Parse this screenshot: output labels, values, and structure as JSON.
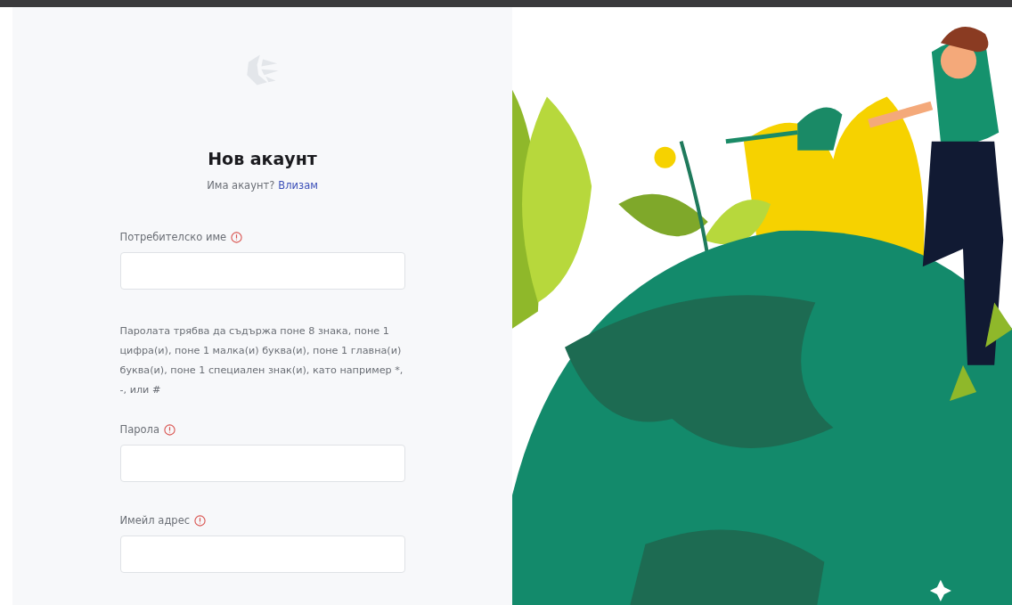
{
  "form": {
    "title": "Нов акаунт",
    "login_prompt": "Има акаунт?",
    "login_link": "Влизам",
    "items": [
      {
        "kind": "field",
        "label": "Потребителско име",
        "required": true
      },
      {
        "kind": "hint",
        "text": "Паролата трябва да съдържа поне 8 знака, поне 1 цифра(и), поне 1 малка(и) буква(и), поне 1 главна(и) буква(и), поне 1 специален знак(и), като например *, -, или #"
      },
      {
        "kind": "field",
        "label": "Парола",
        "required": true
      },
      {
        "kind": "field",
        "label": "Имейл адрес",
        "required": true
      }
    ]
  }
}
